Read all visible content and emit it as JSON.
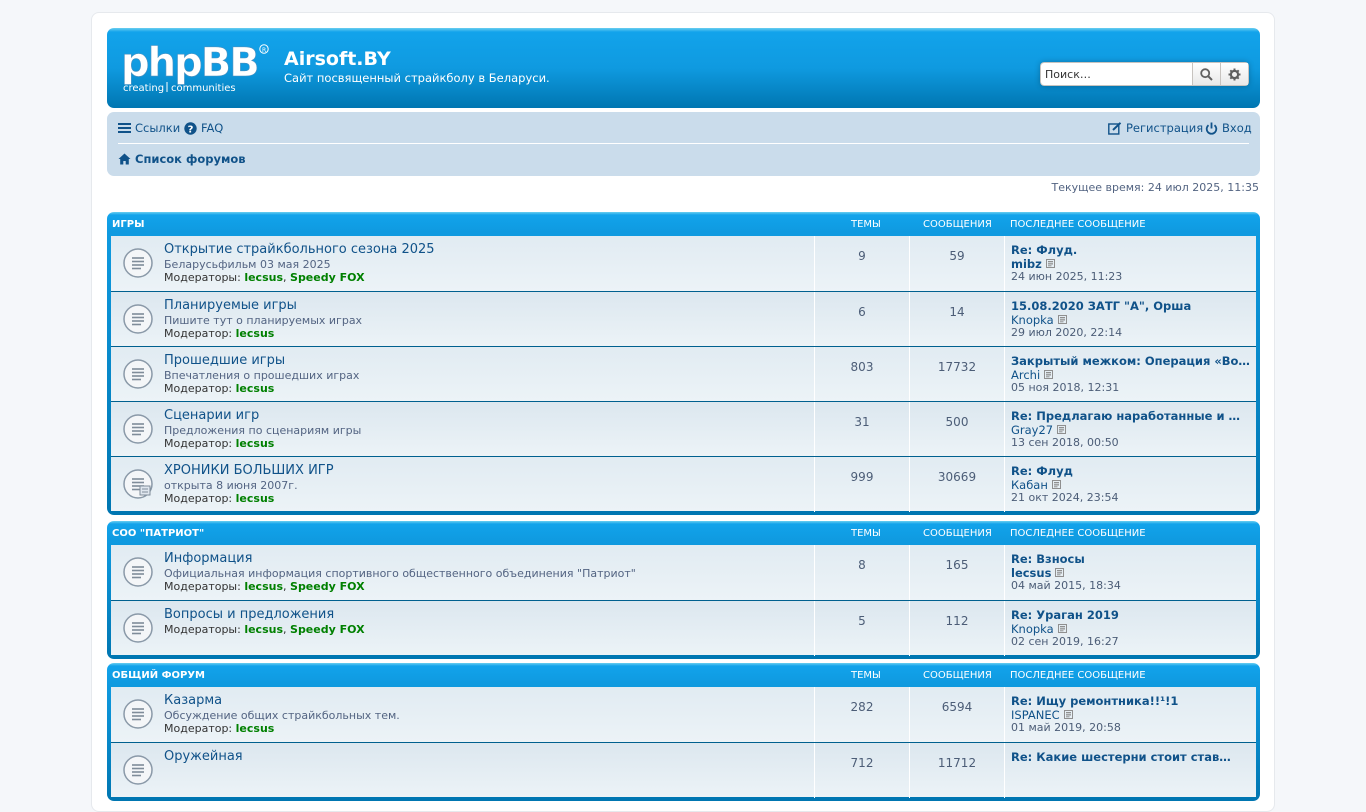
{
  "header": {
    "logo_text": "phpBB creating communities",
    "site_title": "Airsoft.BY",
    "site_description": "Сайт посвященный страйкболу в Беларуси.",
    "search_placeholder": "Поиск…",
    "search_icon": "search-icon",
    "advanced_search_icon": "gear-icon"
  },
  "navbar": {
    "links_label": "Ссылки",
    "faq_label": "FAQ",
    "register_label": "Регистрация",
    "login_label": "Вход",
    "breadcrumb_label": "Список форумов"
  },
  "current_time": "Текущее время: 24 июл 2025, 11:35",
  "columns": {
    "topics": "Темы",
    "posts": "Сообщения",
    "last_post": "Последнее сообщение"
  },
  "categories": [
    {
      "name": "Игры",
      "forums": [
        {
          "name": "Открытие страйкбольного сезона 2025",
          "desc": "Беларусьфильм 03 мая 2025",
          "mods_label": "Модераторы:",
          "mods": [
            "lecsus",
            "Speedy FOX"
          ],
          "topics": "9",
          "posts": "59",
          "last_title": "Re: Флуд.",
          "last_author": "mibz",
          "author_style": "green",
          "last_time": "24 июн 2025, 11:23"
        },
        {
          "name": "Планируемые игры",
          "desc": "Пишите тут о планируемых играх",
          "mods_label": "Модератор:",
          "mods": [
            "lecsus"
          ],
          "topics": "6",
          "posts": "14",
          "last_title": "15.08.2020 ЗАТГ \"А\", Орша",
          "last_author": "Knopka",
          "author_style": "blue",
          "last_time": "29 июл 2020, 22:14"
        },
        {
          "name": "Прошедшие игры",
          "desc": "Впечатления о прошедших играх",
          "mods_label": "Модератор:",
          "mods": [
            "lecsus"
          ],
          "topics": "803",
          "posts": "17732",
          "last_title": "Закрытый межком: Операция «Во…",
          "last_author": "Archi",
          "author_style": "blue",
          "last_time": "05 ноя 2018, 12:31"
        },
        {
          "name": "Сценарии игр",
          "desc": "Предложения по сценариям игры",
          "mods_label": "Модератор:",
          "mods": [
            "lecsus"
          ],
          "topics": "31",
          "posts": "500",
          "last_title": "Re: Предлагаю наработанные и …",
          "last_author": "Gray27",
          "author_style": "blue",
          "last_time": "13 сен 2018, 00:50"
        },
        {
          "name": "ХРОНИКИ БОЛЬШИХ ИГР",
          "desc": "открыта 8 июня 2007г.",
          "mods_label": "Модератор:",
          "mods": [
            "lecsus"
          ],
          "topics": "999",
          "posts": "30669",
          "last_title": "Re: Флуд",
          "last_author": "Кабан",
          "author_style": "blue",
          "last_time": "21 окт 2024, 23:54",
          "subforum_icon": true
        }
      ]
    },
    {
      "name": "СОО \"Патриот\"",
      "forums": [
        {
          "name": "Информация",
          "desc": "Официальная информация спортивного общественного объединения \"Патриот\"",
          "mods_label": "Модераторы:",
          "mods": [
            "lecsus",
            "Speedy FOX"
          ],
          "topics": "8",
          "posts": "165",
          "last_title": "Re: Взносы",
          "last_author": "lecsus",
          "author_style": "green",
          "last_time": "04 май 2015, 18:34"
        },
        {
          "name": "Вопросы и предложения",
          "desc": "",
          "mods_label": "Модераторы:",
          "mods": [
            "lecsus",
            "Speedy FOX"
          ],
          "topics": "5",
          "posts": "112",
          "last_title": "Re: Ураган 2019",
          "last_author": "Knopka",
          "author_style": "blue",
          "last_time": "02 сен 2019, 16:27"
        }
      ]
    },
    {
      "name": "Общий форум",
      "forums": [
        {
          "name": "Казарма",
          "desc": "Обсуждение общих страйкбольных тем.",
          "mods_label": "Модератор:",
          "mods": [
            "lecsus"
          ],
          "topics": "282",
          "posts": "6594",
          "last_title": "Re: Ищу ремонтника!!¹!1",
          "last_author": "ISPANEC",
          "author_style": "blue",
          "last_time": "01 май 2019, 20:58"
        },
        {
          "name": "Оружейная",
          "desc": "",
          "mods_label": "",
          "mods": [],
          "topics": "712",
          "posts": "11712",
          "last_title": "Re: Какие шестерни стоит став…",
          "last_author": "",
          "author_style": "blue",
          "last_time": ""
        }
      ]
    }
  ]
}
